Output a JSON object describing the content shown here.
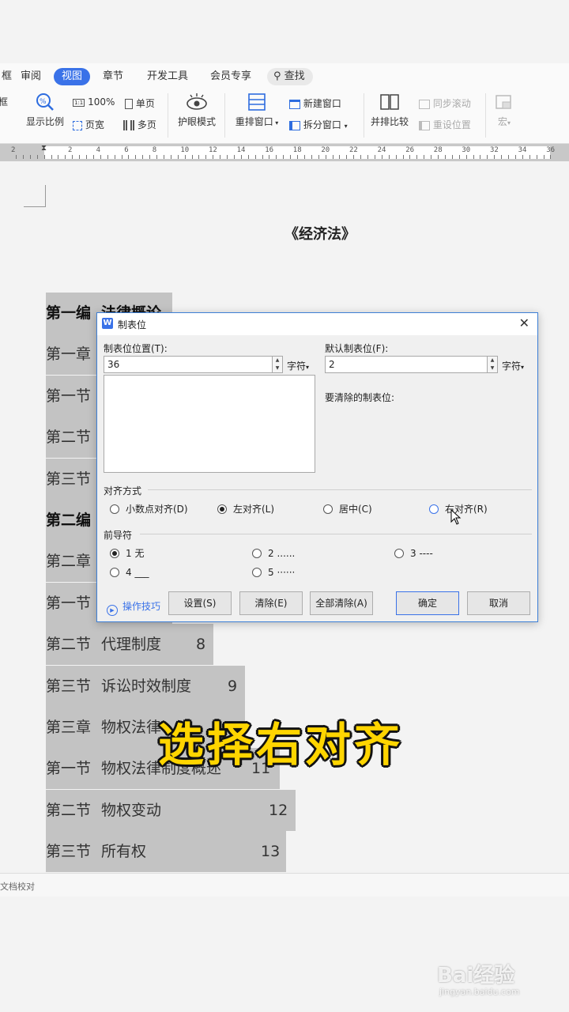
{
  "ribbon": {
    "left_cut": "框",
    "tabs": [
      "审阅",
      "视图",
      "章节",
      "开发工具",
      "会员专享"
    ],
    "active_tab": "视图",
    "search_label": "查找",
    "tools": {
      "zoom_label": "显示比例",
      "pct_label": "100%",
      "page_width_label": "页宽",
      "single_page_label": "单页",
      "multi_page_label": "多页",
      "eye_mode_label": "护眼模式",
      "rearrange_label": "重排窗口",
      "new_window_label": "新建窗口",
      "split_window_label": "拆分窗口",
      "side_by_side_label": "并排比较",
      "sync_scroll_label": "同步滚动",
      "reset_pos_label": "重设位置",
      "macro_label": "宏"
    }
  },
  "ruler": {
    "numbers": [
      "2",
      "2",
      "4",
      "6",
      "8",
      "10",
      "12",
      "14",
      "16",
      "18",
      "20",
      "22",
      "24",
      "26",
      "28",
      "30",
      "32",
      "34",
      "36"
    ]
  },
  "document": {
    "title": "《经济法》",
    "rows": [
      {
        "num": "第一编",
        "text": "法律概论",
        "page": "",
        "bold": true
      },
      {
        "num": "第一章",
        "text": "",
        "page": "",
        "bold": false
      },
      {
        "num": "第一节",
        "text": "",
        "page": "",
        "bold": false
      },
      {
        "num": "第二节",
        "text": "",
        "page": "",
        "bold": false
      },
      {
        "num": "第三节",
        "text": "",
        "page": "",
        "bold": false
      },
      {
        "num": "第二编",
        "text": "",
        "page": "",
        "bold": true
      },
      {
        "num": "第二章",
        "text": "",
        "page": "",
        "bold": false
      },
      {
        "num": "第一节",
        "text": "",
        "page": "",
        "bold": false
      },
      {
        "num": "第二节",
        "text": "代理制度",
        "page": "8",
        "bold": false
      },
      {
        "num": "第三节",
        "text": "诉讼时效制度",
        "page": "9",
        "bold": false
      },
      {
        "num": "第三章",
        "text": "物权法律",
        "page": "",
        "bold": false
      },
      {
        "num": "第一节",
        "text": "物权法律制度概述",
        "page": "11",
        "bold": false
      },
      {
        "num": "第二节",
        "text": "物权变动",
        "page": "12",
        "bold": false
      },
      {
        "num": "第三节",
        "text": "所有权",
        "page": "13",
        "bold": false
      }
    ]
  },
  "statusbar": {
    "text": "文档校对"
  },
  "dialog": {
    "title": "制表位",
    "tab_pos_label": "制表位位置(T):",
    "tab_pos_value": "36",
    "unit_left": "字符",
    "default_tab_label": "默认制表位(F):",
    "default_tab_value": "2",
    "unit_right": "字符",
    "to_clear_label": "要清除的制表位:",
    "align_group": "对齐方式",
    "align_options": [
      "小数点对齐(D)",
      "左对齐(L)",
      "居中(C)",
      "右对齐(R)"
    ],
    "align_selected": "左对齐(L)",
    "leader_group": "前导符",
    "leader_options": [
      "1 无",
      "2 ......",
      "3 ----",
      "4 ___",
      "5 ······"
    ],
    "leader_selected": "1 无",
    "tips_label": "操作技巧",
    "buttons": {
      "set": "设置(S)",
      "clear": "清除(E)",
      "clear_all": "全部清除(A)",
      "ok": "确定",
      "cancel": "取消"
    }
  },
  "caption": "选择右对齐",
  "watermark": {
    "brand": "Bai经验",
    "url": "jingyan.baidu.com"
  }
}
